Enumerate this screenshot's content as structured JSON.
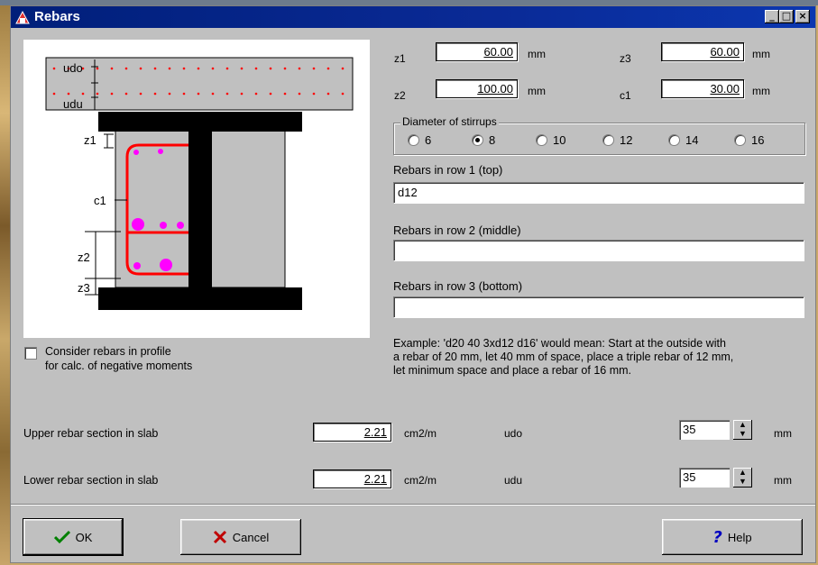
{
  "window": {
    "title": "Rebars"
  },
  "titlebar_buttons": {
    "minimize": "_",
    "maximize": "□",
    "close": "×"
  },
  "drawing": {
    "udo": "udo",
    "udu": "udu",
    "z1": "z1",
    "c1": "c1",
    "z2": "z2",
    "z3": "z3"
  },
  "params": {
    "z1": {
      "label": "z1",
      "value": "60.00",
      "unit": "mm"
    },
    "z2": {
      "label": "z2",
      "value": "100.00",
      "unit": "mm"
    },
    "z3": {
      "label": "z3",
      "value": "60.00",
      "unit": "mm"
    },
    "c1": {
      "label": "c1",
      "value": "30.00",
      "unit": "mm"
    }
  },
  "stirrups": {
    "label": "Diameter of stirrups",
    "options": [
      "6",
      "8",
      "10",
      "12",
      "14",
      "16"
    ],
    "selected": "8"
  },
  "rows": {
    "row1": {
      "label": "Rebars in row 1 (top)",
      "value": "d12"
    },
    "row2": {
      "label": "Rebars in row 2 (middle)",
      "value": ""
    },
    "row3": {
      "label": "Rebars in row 3 (bottom)",
      "value": ""
    }
  },
  "example": {
    "line1": "Example: 'd20 40 3xd12 d16' would mean: Start at the outside with",
    "line2": "a rebar of 20 mm, let 40 mm of space, place a triple rebar of 12 mm,",
    "line3": "let minimum space and place a rebar of 16 mm."
  },
  "profile_option": {
    "line1": "Consider rebars in profile",
    "line2": "for calc. of negative moments",
    "checked": false
  },
  "slab": {
    "upper": {
      "label": "Upper rebar section in slab",
      "value": "2.21",
      "unit": "cm2/m",
      "spin_label": "udo",
      "spin_value": "35",
      "spin_unit": "mm"
    },
    "lower": {
      "label": "Lower rebar section in slab",
      "value": "2.21",
      "unit": "cm2/m",
      "spin_label": "udu",
      "spin_value": "35",
      "spin_unit": "mm"
    }
  },
  "buttons": {
    "ok": "OK",
    "cancel": "Cancel",
    "help": "Help"
  },
  "icons": {
    "ok": "checkmark-icon",
    "cancel": "x-icon",
    "help": "question-icon"
  },
  "colors": {
    "title_bar": "#0a2a96",
    "rebar_red": "#ff0000",
    "rebar_magenta": "#ff00ff",
    "ok_green": "#008000",
    "cancel_red": "#c00000",
    "help_blue": "#0000c0"
  }
}
